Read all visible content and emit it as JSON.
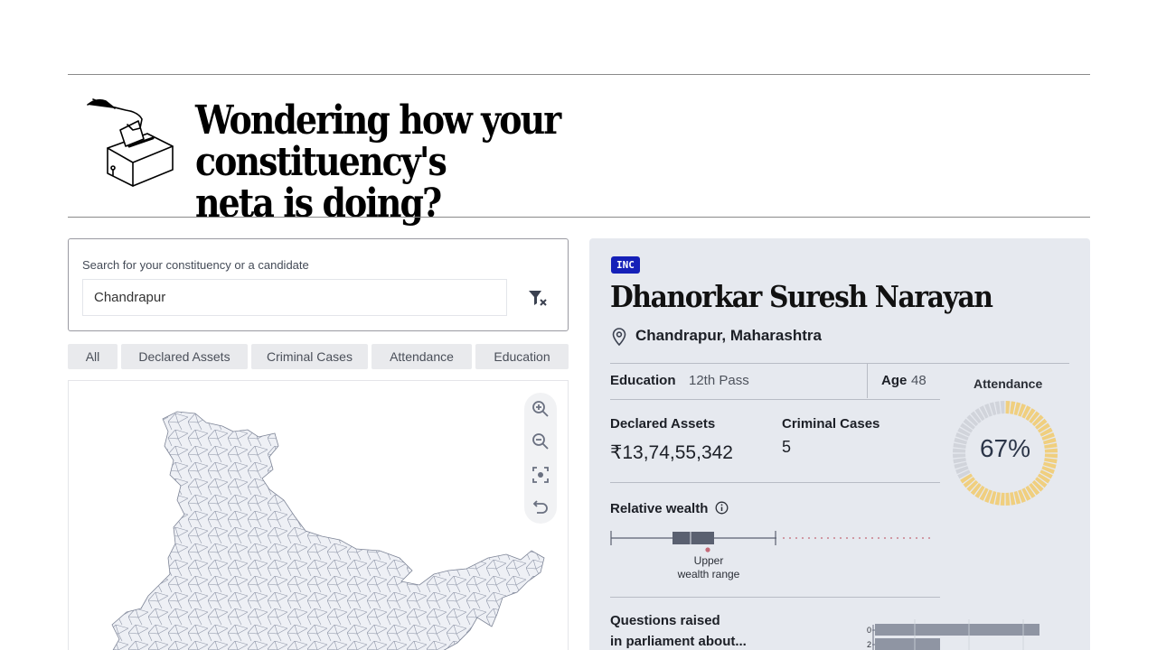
{
  "header": {
    "headline_line1": "Wondering how your constituency's",
    "headline_line2": "neta is doing?"
  },
  "search": {
    "label": "Search for your constituency or a candidate",
    "value": "Chandrapur",
    "placeholder": "Chandrapur"
  },
  "tabs": [
    "All",
    "Declared Assets",
    "Criminal Cases",
    "Attendance",
    "Education"
  ],
  "candidate": {
    "party": "INC",
    "name": "Dhanorkar Suresh Narayan",
    "location": "Chandrapur, Maharashtra",
    "education_label": "Education",
    "education_value": "12th Pass",
    "age_label": "Age",
    "age_value": "48",
    "assets_label": "Declared Assets",
    "assets_value": "₹13,74,55,342",
    "criminal_label": "Criminal Cases",
    "criminal_value": "5",
    "attendance_label": "Attendance",
    "attendance_value": "67%",
    "attendance_fraction": 0.67,
    "wealth_label": "Relative wealth",
    "wealth_note_line1": "Upper",
    "wealth_note_line2": "wealth range",
    "questions_title_line1": "Questions raised",
    "questions_title_line2": "in parliament about...",
    "questions_axis_ticks": [
      "0",
      "2"
    ]
  },
  "colors": {
    "party_badge": "#1520b8",
    "attendance_present": "#f0cf7f",
    "attendance_absent": "#d1d4db",
    "card_bg": "#e6e9ef"
  },
  "icons": {
    "ballot": "ballot-box-icon",
    "filter_clear": "filter-clear-icon",
    "location": "map-pin-icon",
    "info": "info-icon",
    "zoom_in": "zoom-in-icon",
    "zoom_out": "zoom-out-icon",
    "focus": "focus-icon",
    "reset": "reset-icon"
  }
}
